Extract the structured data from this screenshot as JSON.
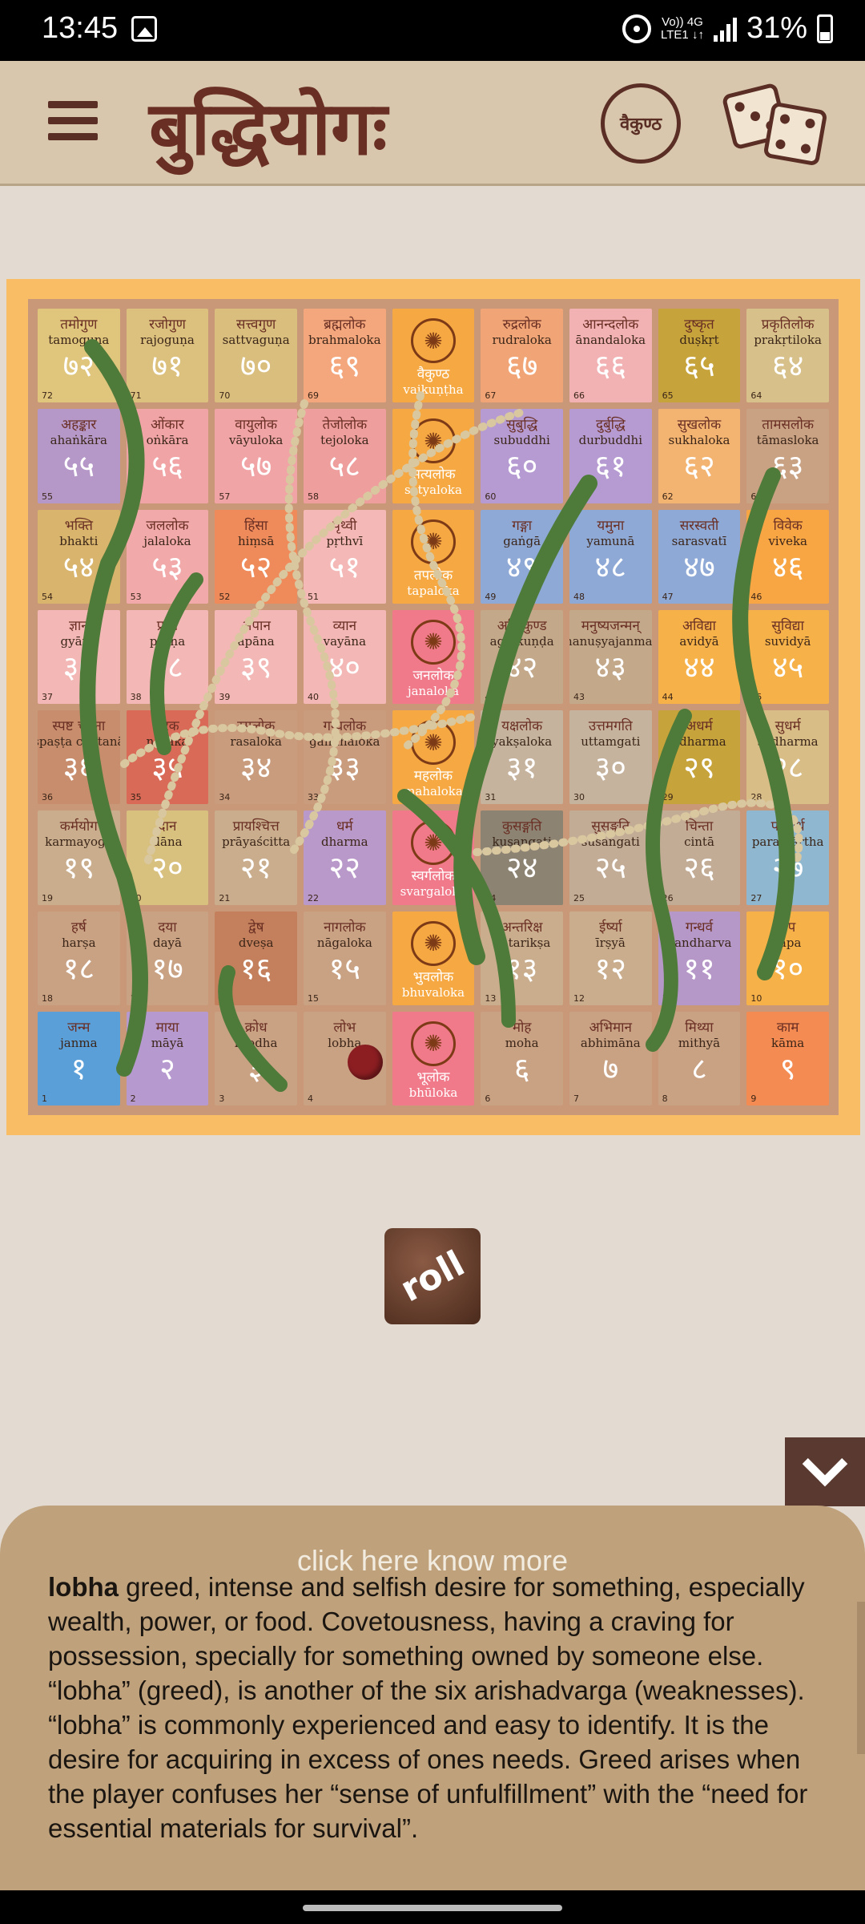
{
  "status_bar": {
    "time": "13:45",
    "network_top": "Vo)) 4G",
    "network_bottom": "LTE1 ↓↑",
    "battery": "31%"
  },
  "header": {
    "title": "बुद्धियोगः",
    "vaikuntha_label": "वैकुण्ठ",
    "icons": [
      "menu-icon",
      "vaikuntha-cycle-icon",
      "dice-icon"
    ]
  },
  "board": {
    "cells": [
      {
        "dev": "तमोगुण",
        "roman": "tamoguṇa",
        "numeral": "७२",
        "index": "72",
        "color": "#e0c57c"
      },
      {
        "dev": "रजोगुण",
        "roman": "rajoguṇa",
        "numeral": "७१",
        "index": "71",
        "color": "#dcc07e"
      },
      {
        "dev": "सत्त्वगुण",
        "roman": "sattvaguṇa",
        "numeral": "७०",
        "index": "70",
        "color": "#d9be7d"
      },
      {
        "dev": "ब्रह्मलोक",
        "roman": "brahmaloka",
        "numeral": "६९",
        "index": "69",
        "color": "#f4a77d"
      },
      {
        "dev": "वैकुण्ठ",
        "roman": "vaikuṇṭha",
        "numeral": "",
        "index": "",
        "color": "#f6a942",
        "chakra": true
      },
      {
        "dev": "रुद्रलोक",
        "roman": "rudraloka",
        "numeral": "६७",
        "index": "67",
        "color": "#f1a576"
      },
      {
        "dev": "आनन्दलोक",
        "roman": "ānandaloka",
        "numeral": "६६",
        "index": "66",
        "color": "#f2b1b2"
      },
      {
        "dev": "दुष्कृत",
        "roman": "duṣkṛt",
        "numeral": "६५",
        "index": "65",
        "color": "#c6a43b"
      },
      {
        "dev": "प्रकृतिलोक",
        "roman": "prakṛtiloka",
        "numeral": "६४",
        "index": "64",
        "color": "#d7c08a"
      },
      {
        "dev": "अहङ्कार",
        "roman": "ahaṅkāra",
        "numeral": "५५",
        "index": "55",
        "color": "#b698c8"
      },
      {
        "dev": "ओंकार",
        "roman": "oṅkāra",
        "numeral": "५६",
        "index": "56",
        "color": "#f0a4a6"
      },
      {
        "dev": "वायुलोक",
        "roman": "vāyuloka",
        "numeral": "५७",
        "index": "57",
        "color": "#f0a4a6"
      },
      {
        "dev": "तेजोलोक",
        "roman": "tejoloka",
        "numeral": "५८",
        "index": "58",
        "color": "#ef9e9e"
      },
      {
        "dev": "सत्यलोक",
        "roman": "satyaloka",
        "numeral": "",
        "index": "",
        "color": "#f6a942",
        "chakra": true
      },
      {
        "dev": "सुबुद्धि",
        "roman": "subuddhi",
        "numeral": "६०",
        "index": "60",
        "color": "#b59bd2"
      },
      {
        "dev": "दुर्बुद्धि",
        "roman": "durbuddhi",
        "numeral": "६१",
        "index": "61",
        "color": "#b59bd2"
      },
      {
        "dev": "सुखलोक",
        "roman": "sukhaloka",
        "numeral": "६२",
        "index": "62",
        "color": "#f3b472"
      },
      {
        "dev": "तामसलोक",
        "roman": "tāmasloka",
        "numeral": "६३",
        "index": "63",
        "color": "#c9a183"
      },
      {
        "dev": "भक्ति",
        "roman": "bhakti",
        "numeral": "५४",
        "index": "54",
        "color": "#d8b46c"
      },
      {
        "dev": "जललोक",
        "roman": "jalaloka",
        "numeral": "५३",
        "index": "53",
        "color": "#f1a9a9"
      },
      {
        "dev": "हिंसा",
        "roman": "hiṃsā",
        "numeral": "५२",
        "index": "52",
        "color": "#ef8a5a"
      },
      {
        "dev": "पृथ्वी",
        "roman": "pṛthvī",
        "numeral": "५१",
        "index": "51",
        "color": "#f4b9b6"
      },
      {
        "dev": "तपलोक",
        "roman": "tapaloka",
        "numeral": "",
        "index": "",
        "color": "#f6a942",
        "chakra": true
      },
      {
        "dev": "गङ्गा",
        "roman": "gaṅgā",
        "numeral": "४९",
        "index": "49",
        "color": "#8fa9d6"
      },
      {
        "dev": "यमुना",
        "roman": "yamunā",
        "numeral": "४८",
        "index": "48",
        "color": "#8fa9d6"
      },
      {
        "dev": "सरस्वती",
        "roman": "sarasvatī",
        "numeral": "४७",
        "index": "47",
        "color": "#8fa9d6"
      },
      {
        "dev": "विवेक",
        "roman": "viveka",
        "numeral": "४६",
        "index": "46",
        "color": "#f8a544"
      },
      {
        "dev": "ज्ञान",
        "roman": "gyāna",
        "numeral": "३७",
        "index": "37",
        "color": "#f3b7b5"
      },
      {
        "dev": "प्राण",
        "roman": "prāṇa",
        "numeral": "३८",
        "index": "38",
        "color": "#f3b7b5"
      },
      {
        "dev": "अपान",
        "roman": "apāna",
        "numeral": "३९",
        "index": "39",
        "color": "#f3b7b5"
      },
      {
        "dev": "व्यान",
        "roman": "vayāna",
        "numeral": "४०",
        "index": "40",
        "color": "#f3b7b5"
      },
      {
        "dev": "जनलोक",
        "roman": "janaloka",
        "numeral": "",
        "index": "",
        "color": "#f07a8a",
        "chakra": true
      },
      {
        "dev": "अग्निकुण्ड",
        "roman": "agnikuṇḍa",
        "numeral": "४२",
        "index": "42",
        "color": "#c3a88a"
      },
      {
        "dev": "मनुष्यजन्मन्",
        "roman": "manuṣyajanman",
        "numeral": "४३",
        "index": "43",
        "color": "#c3a88a"
      },
      {
        "dev": "अविद्या",
        "roman": "avidyā",
        "numeral": "४४",
        "index": "44",
        "color": "#f6b249"
      },
      {
        "dev": "सुविद्या",
        "roman": "suvidyā",
        "numeral": "४५",
        "index": "45",
        "color": "#f6b249"
      },
      {
        "dev": "स्पष्ट चेतना",
        "roman": "spaṣṭa chetanā",
        "numeral": "३६",
        "index": "36",
        "color": "#c88d6c"
      },
      {
        "dev": "नरक",
        "roman": "naraka",
        "numeral": "३५",
        "index": "35",
        "color": "#d86a57"
      },
      {
        "dev": "रसलोक",
        "roman": "rasaloka",
        "numeral": "३४",
        "index": "34",
        "color": "#c99c7e"
      },
      {
        "dev": "गन्धलोक",
        "roman": "gandhaloka",
        "numeral": "३३",
        "index": "33",
        "color": "#c99c7e"
      },
      {
        "dev": "महलोक",
        "roman": "mahaloka",
        "numeral": "",
        "index": "",
        "color": "#f6a942",
        "chakra": true
      },
      {
        "dev": "यक्षलोक",
        "roman": "yakṣaloka",
        "numeral": "३१",
        "index": "31",
        "color": "#c6b39d"
      },
      {
        "dev": "उत्तमगति",
        "roman": "uttamgati",
        "numeral": "३०",
        "index": "30",
        "color": "#c6b39d"
      },
      {
        "dev": "अधर्म",
        "roman": "adharma",
        "numeral": "२९",
        "index": "29",
        "color": "#c6a43b"
      },
      {
        "dev": "सुधर्म",
        "roman": "sudharma",
        "numeral": "२८",
        "index": "28",
        "color": "#d8bd87"
      },
      {
        "dev": "कर्मयोग",
        "roman": "karmayoga",
        "numeral": "१९",
        "index": "19",
        "color": "#c9ad8c"
      },
      {
        "dev": "दान",
        "roman": "dāna",
        "numeral": "२०",
        "index": "20",
        "color": "#d8c07e"
      },
      {
        "dev": "प्रायश्चित्त",
        "roman": "prāyaścitta",
        "numeral": "२१",
        "index": "21",
        "color": "#c9ad8c"
      },
      {
        "dev": "धर्म",
        "roman": "dharma",
        "numeral": "२२",
        "index": "22",
        "color": "#b999c9"
      },
      {
        "dev": "स्वर्गलोक",
        "roman": "svargaloka",
        "numeral": "",
        "index": "",
        "color": "#f07a8a",
        "chakra": true
      },
      {
        "dev": "कुसङ्गति",
        "roman": "kusangati",
        "numeral": "२४",
        "index": "24",
        "color": "#8c8372"
      },
      {
        "dev": "सुसङ्गति",
        "roman": "susangati",
        "numeral": "२५",
        "index": "25",
        "color": "#c3ac95"
      },
      {
        "dev": "चिन्ता",
        "roman": "cintā",
        "numeral": "२६",
        "index": "26",
        "color": "#c3ac95"
      },
      {
        "dev": "परमार्थ",
        "roman": "paramārtha",
        "numeral": "२७",
        "index": "27",
        "color": "#8fb7cf"
      },
      {
        "dev": "हर्ष",
        "roman": "harṣa",
        "numeral": "१८",
        "index": "18",
        "color": "#c9a183"
      },
      {
        "dev": "दया",
        "roman": "dayā",
        "numeral": "१७",
        "index": "17",
        "color": "#c9a183"
      },
      {
        "dev": "द्वेष",
        "roman": "dveṣa",
        "numeral": "१६",
        "index": "16",
        "color": "#c4805c"
      },
      {
        "dev": "नागलोक",
        "roman": "nāgaloka",
        "numeral": "१५",
        "index": "15",
        "color": "#c9a183"
      },
      {
        "dev": "भुवलोक",
        "roman": "bhuvaloka",
        "numeral": "",
        "index": "",
        "color": "#f6a942",
        "chakra": true
      },
      {
        "dev": "अन्तरिक्ष",
        "roman": "antarikṣa",
        "numeral": "१३",
        "index": "13",
        "color": "#c9ad8c"
      },
      {
        "dev": "ईर्ष्या",
        "roman": "īrṣyā",
        "numeral": "१२",
        "index": "12",
        "color": "#c9ad8c"
      },
      {
        "dev": "गन्धर्व",
        "roman": "gandharva",
        "numeral": "११",
        "index": "11",
        "color": "#b698c8"
      },
      {
        "dev": "तप",
        "roman": "tapa",
        "numeral": "१०",
        "index": "10",
        "color": "#f6b249"
      },
      {
        "dev": "जन्म",
        "roman": "janma",
        "numeral": "१",
        "index": "1",
        "color": "#5b9fd9"
      },
      {
        "dev": "माया",
        "roman": "māyā",
        "numeral": "२",
        "index": "2",
        "color": "#b699cf"
      },
      {
        "dev": "क्रोध",
        "roman": "krodha",
        "numeral": "३",
        "index": "3",
        "color": "#c9a183"
      },
      {
        "dev": "लोभ",
        "roman": "lobha",
        "numeral": "",
        "index": "4",
        "color": "#c9a183"
      },
      {
        "dev": "भूलोक",
        "roman": "bhūloka",
        "numeral": "",
        "index": "",
        "color": "#f07a8a",
        "chakra": true
      },
      {
        "dev": "मोह",
        "roman": "moha",
        "numeral": "६",
        "index": "6",
        "color": "#c9a183"
      },
      {
        "dev": "अभिमान",
        "roman": "abhimāna",
        "numeral": "७",
        "index": "7",
        "color": "#c9a183"
      },
      {
        "dev": "मिथ्या",
        "roman": "mithyā",
        "numeral": "८",
        "index": "8",
        "color": "#c9a183"
      },
      {
        "dev": "काम",
        "roman": "kāma",
        "numeral": "९",
        "index": "9",
        "color": "#f48b52"
      }
    ]
  },
  "roll_button": {
    "label": "roll"
  },
  "info_panel": {
    "link": "click here know more",
    "term": "lobha",
    "text": " greed, intense and selfish desire for something, especially wealth, power, or food. Covetousness, having a craving for possession, specially for something owned by someone else. “lobha” (greed), is another of the six arishadvarga (weaknesses). “lobha” is commonly experienced and easy to identify. It is the desire for acquiring in excess of ones needs. Greed arises when the player confuses her “sense of unfulfillment” with the “need for essential materials for survival”."
  }
}
